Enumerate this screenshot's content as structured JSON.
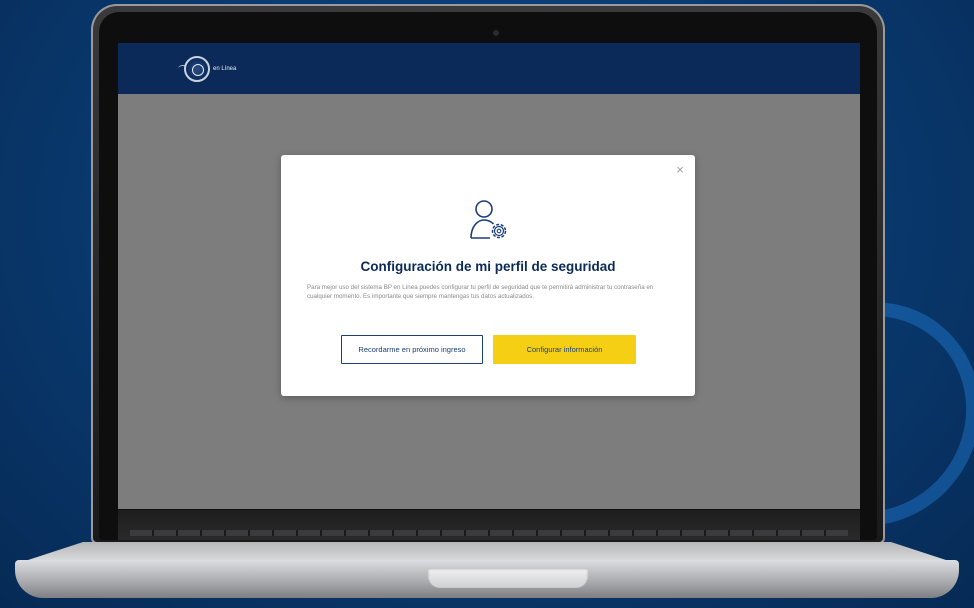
{
  "app": {
    "logo_text": "en Línea"
  },
  "modal": {
    "close_label": "×",
    "title": "Configuración de mi perfil de seguridad",
    "description": "Para mejor uso del sistema BP en Línea puedes configurar tu perfil de seguridad que te permitirá administrar tu contraseña en cualquier momento. Es importante que siempre mantengas tus datos actualizados.",
    "icon": "user-gear-icon",
    "buttons": {
      "remind_label": "Recordarme en próximo ingreso",
      "configure_label": "Configurar información"
    }
  },
  "colors": {
    "header": "#0b2a5a",
    "primary_button": "#f5cf14",
    "title": "#0b2a5a",
    "overlay": "#7d7d7d"
  }
}
